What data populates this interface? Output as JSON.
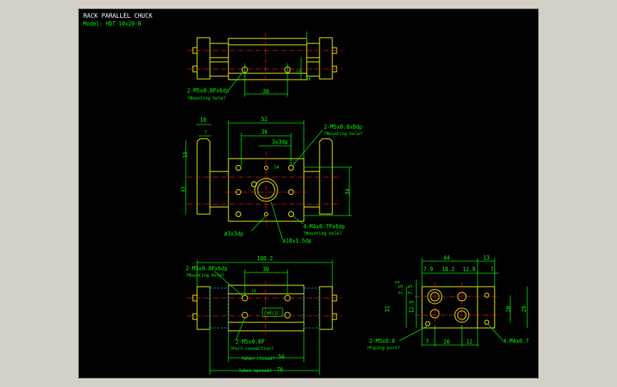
{
  "title": "RACK PARALLEL CHUCK",
  "model": "Model: HDT 10x20-B",
  "colors": {
    "background": "#000000",
    "outline": "#ffff00",
    "dimension": "#00ff00",
    "center": "#ff2020",
    "hidden": "#00c8ff"
  },
  "top_view": {
    "dim_30": "30",
    "dim_h1": "15",
    "dim_h2": "ø6",
    "note_thread": "2-M5x0.8Px6dp",
    "note_sub": "?Mounting hole?"
  },
  "front_view": {
    "dim_10": "10",
    "dim_7": "7",
    "dim_52": "52",
    "dim_36": "36",
    "dim_3x3": "3x3dp",
    "dim_15": "15",
    "dim_37": "37",
    "dim_34": "34",
    "dim_14": "14",
    "note_top": "2-M5x0.8x8dp",
    "note_top_sub": "?Mounting hole?",
    "note_bottom": "4-M4x0.7Px6dp",
    "note_bottom_sub": "?Mounting hole?",
    "note_pin": "ø3x3dp",
    "note_bore": "ø18x1.5dp"
  },
  "bottom_view": {
    "dim_100": "100.2",
    "dim_30": "30",
    "dim_56": "56",
    "dim_76": "76",
    "note_thread": "2-M5x0.8Px6dp",
    "note_thread_sub": "?Mounting hole?",
    "note_port": "2-M5x0.8P",
    "note_port_sub": "?Port connection?",
    "label_closed": "?when closed?",
    "label_opened": "?when opened?",
    "label_plate": "CHELIC",
    "dim_small": "15"
  },
  "side_view": {
    "dim_44": "44",
    "dim_13": "13",
    "dim_79": "7.9",
    "dim_182": "18.2",
    "dim_129": "12.9",
    "dim_7a": "7",
    "dim_1": "1",
    "dim_75a": "7.5",
    "dim_75b": "7.5",
    "dim_125": "12.5",
    "dim_31": "31",
    "dim_20v": "20",
    "dim_29": "29",
    "dim_7b": "7",
    "dim_20h": "20",
    "dim_12": "12",
    "note_port": "2-M5x0.8",
    "note_port_sub": "?Piping port?",
    "note_thread": "4-M4x0.7"
  }
}
